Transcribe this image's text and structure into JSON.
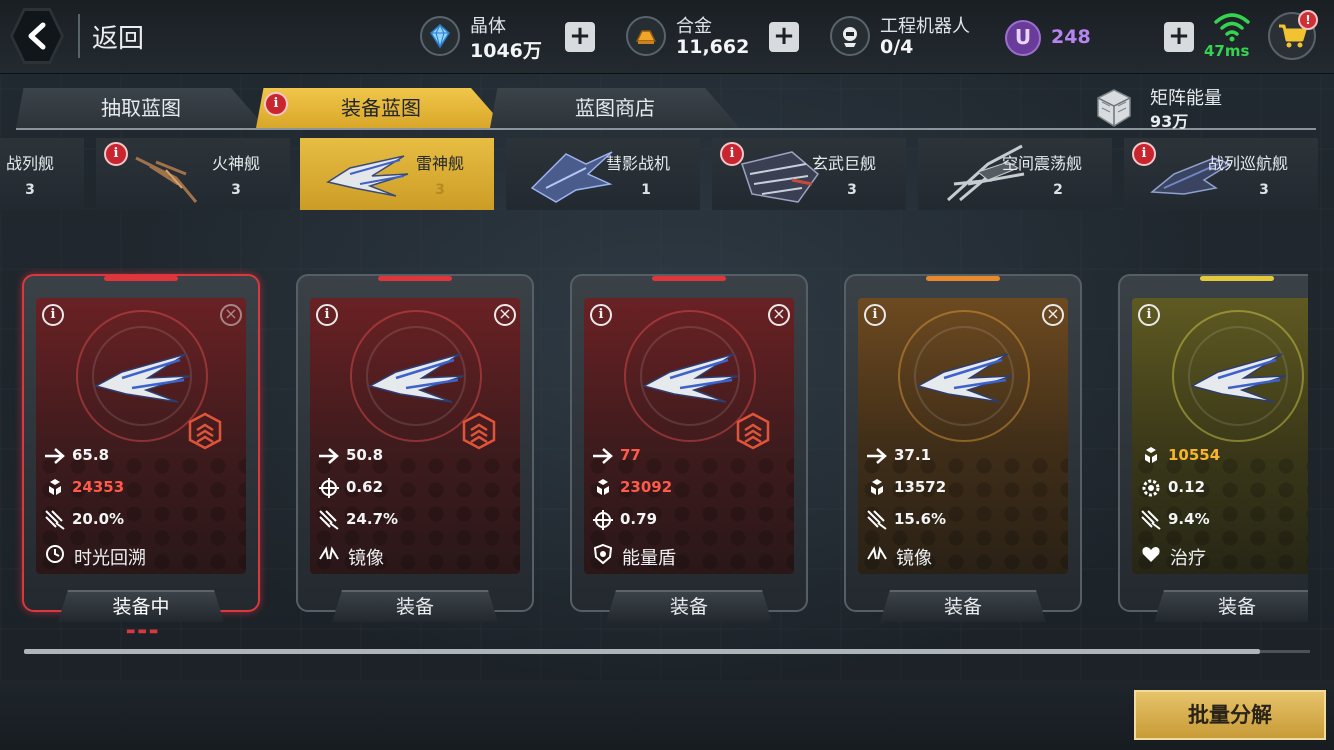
{
  "header": {
    "back_label": "返回",
    "resources": [
      {
        "icon": "crystal-icon",
        "name": "晶体",
        "value": "1046万"
      },
      {
        "icon": "alloy-icon",
        "name": "合金",
        "value": "11,662"
      },
      {
        "icon": "robot-icon",
        "name": "工程机器人",
        "value": "0/4"
      }
    ],
    "u_currency": {
      "symbol": "U",
      "value": "248"
    },
    "ping": "47ms",
    "cart_alert": "!"
  },
  "tabs": [
    {
      "label": "抽取蓝图",
      "active": false
    },
    {
      "label": "装备蓝图",
      "active": true,
      "alert": "i"
    },
    {
      "label": "蓝图商店",
      "active": false
    }
  ],
  "matrix_energy": {
    "label": "矩阵能量",
    "value": "93万"
  },
  "ships": [
    {
      "name": "战列舰",
      "count": "3",
      "alert": false
    },
    {
      "name": "火神舰",
      "count": "3",
      "alert": true
    },
    {
      "name": "雷神舰",
      "count": "3",
      "alert": false,
      "active": true
    },
    {
      "name": "彗影战机",
      "count": "1",
      "alert": false
    },
    {
      "name": "玄武巨舰",
      "count": "3",
      "alert": true
    },
    {
      "name": "空间震荡舰",
      "count": "2",
      "alert": false
    },
    {
      "name": "战列巡航舰",
      "count": "3",
      "alert": true
    }
  ],
  "cards": [
    {
      "rarity": "red",
      "selected": true,
      "stats": [
        {
          "icon": "speed-icon",
          "value": "65.8",
          "hl": ""
        },
        {
          "icon": "shield-hex-icon",
          "value": "24353",
          "hl": "red"
        },
        {
          "icon": "fire-icon",
          "value": "20.0%",
          "hl": ""
        }
      ],
      "skill": {
        "icon": "time-rewind-icon",
        "label": "时光回溯"
      },
      "button": "装备中",
      "rank": true
    },
    {
      "rarity": "red",
      "selected": false,
      "stats": [
        {
          "icon": "speed-icon",
          "value": "50.8",
          "hl": ""
        },
        {
          "icon": "crosshair-icon",
          "value": "0.62",
          "hl": ""
        },
        {
          "icon": "fire-icon",
          "value": "24.7%",
          "hl": ""
        }
      ],
      "skill": {
        "icon": "mirror-icon",
        "label": "镜像"
      },
      "button": "装备",
      "rank": true
    },
    {
      "rarity": "red",
      "selected": false,
      "stats": [
        {
          "icon": "speed-icon",
          "value": "77",
          "hl": "red"
        },
        {
          "icon": "shield-hex-icon",
          "value": "23092",
          "hl": "red"
        },
        {
          "icon": "crosshair-icon",
          "value": "0.79",
          "hl": ""
        }
      ],
      "skill": {
        "icon": "energy-shield-icon",
        "label": "能量盾"
      },
      "button": "装备",
      "rank": true
    },
    {
      "rarity": "orange",
      "selected": false,
      "stats": [
        {
          "icon": "speed-icon",
          "value": "37.1",
          "hl": ""
        },
        {
          "icon": "shield-hex-icon",
          "value": "13572",
          "hl": ""
        },
        {
          "icon": "fire-icon",
          "value": "15.6%",
          "hl": ""
        }
      ],
      "skill": {
        "icon": "mirror-icon",
        "label": "镜像"
      },
      "button": "装备",
      "rank": false
    },
    {
      "rarity": "yellow",
      "selected": false,
      "stats": [
        {
          "icon": "shield-hex-icon",
          "value": "10554",
          "hl": "gold"
        },
        {
          "icon": "gear-icon",
          "value": "0.12",
          "hl": ""
        },
        {
          "icon": "fire-icon",
          "value": "9.4%",
          "hl": ""
        }
      ],
      "skill": {
        "icon": "heal-icon",
        "label": "治疗"
      },
      "button": "装备",
      "rank": false
    }
  ],
  "bulk_button": "批量分解",
  "colors": {
    "gold": "#d9a72a",
    "red_highlight": "#ff5a4a",
    "ping_green": "#35d34f",
    "u_purple": "#b884f0"
  }
}
